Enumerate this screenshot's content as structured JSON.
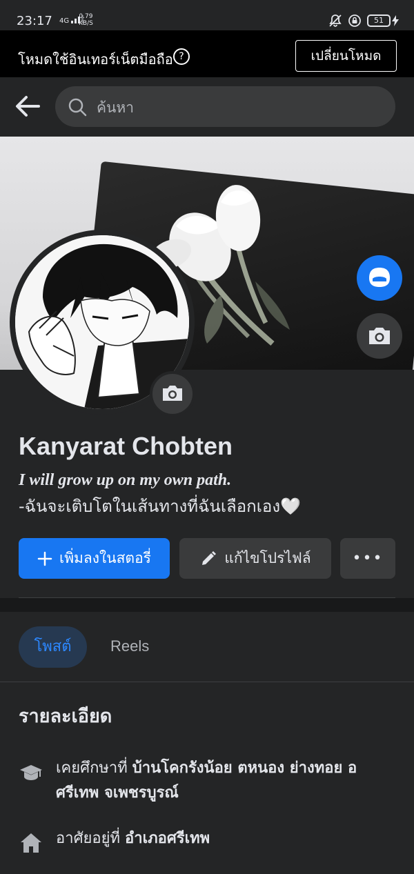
{
  "status_bar": {
    "time": "23:17",
    "network": "4G",
    "speed_value": "0.79",
    "speed_unit": "KB/S",
    "battery": "51"
  },
  "banner": {
    "text": "โหมดใช้อินเทอร์เน็ตมือถือ",
    "help": "?",
    "switch_label": "เปลี่ยนโหมด"
  },
  "search": {
    "placeholder": "ค้นหา"
  },
  "profile": {
    "name": "Kanyarat Chobten",
    "bio_line1": "I will grow up on my own path.",
    "bio_line2": "-ฉันจะเติบโตในเส้นทางที่ฉันเลือกเอง🤍"
  },
  "actions": {
    "add_story": "เพิ่มลงในสตอรี่",
    "edit_profile": "แก้ไขโปรไฟล์",
    "more": "•••"
  },
  "tabs": [
    {
      "label": "โพสต์",
      "active": true
    },
    {
      "label": "Reels",
      "active": false
    }
  ],
  "details": {
    "title": "รายละเอียด",
    "education_prefix": "เคยศึกษาที่",
    "education_value": "บ้านโคกรังน้อย ตหนอง ย่างทอย อศรีเทพ จเพชรบูรณ์",
    "home_prefix": "อาศัยอยู่ที่",
    "home_value": "อำเภอศรีเทพ"
  },
  "colors": {
    "background": "#242526",
    "accent": "#1877f2",
    "button_gray": "#3a3b3c"
  }
}
